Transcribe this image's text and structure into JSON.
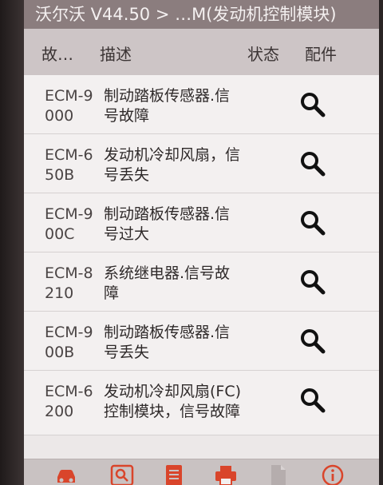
{
  "title": "沃尔沃 V44.50 > …M(发动机控制模块)",
  "columns": {
    "code": "故…",
    "description": "描述",
    "status": "状态",
    "parts": "配件"
  },
  "rows": [
    {
      "code": "ECM-9000",
      "description": "制动踏板传感器.信号故障"
    },
    {
      "code": "ECM-650B",
      "description": "发动机冷却风扇，信号丢失"
    },
    {
      "code": "ECM-900C",
      "description": "制动踏板传感器.信号过大"
    },
    {
      "code": "ECM-8210",
      "description": "系统继电器.信号故障"
    },
    {
      "code": "ECM-900B",
      "description": "制动踏板传感器.信号丢失"
    },
    {
      "code": "ECM-6200",
      "description": "发动机冷却风扇(FC)控制模块，信号故障"
    }
  ],
  "toolbar": {
    "icons": [
      "car-icon",
      "search-icon",
      "report-icon",
      "print-icon",
      "document-icon",
      "info-icon"
    ]
  },
  "colors": {
    "title_bar": "#8b7d7e",
    "header_bar": "#cdc5c6",
    "accent": "#d9452b"
  }
}
